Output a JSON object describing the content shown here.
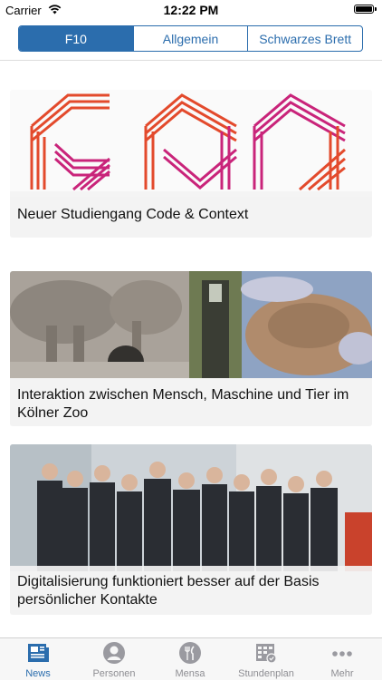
{
  "status_bar": {
    "carrier": "Carrier",
    "time": "12:22 PM"
  },
  "segments": [
    {
      "label": "F10",
      "selected": true
    },
    {
      "label": "Allgemein",
      "selected": false
    },
    {
      "label": "Schwarzes Brett",
      "selected": false
    }
  ],
  "news": [
    {
      "title": "Neuer Studiengang Code & Context"
    },
    {
      "title": "Interaktion zwischen Mensch, Maschine und Tier im Kölner Zoo"
    },
    {
      "title": "Digitalisierung funktioniert besser auf der Basis persönlicher Kontakte"
    }
  ],
  "tabs": [
    {
      "label": "News",
      "icon": "news-icon",
      "active": true
    },
    {
      "label": "Personen",
      "icon": "person-icon",
      "active": false
    },
    {
      "label": "Mensa",
      "icon": "fork-knife-icon",
      "active": false
    },
    {
      "label": "Stundenplan",
      "icon": "timetable-icon",
      "active": false
    },
    {
      "label": "Mehr",
      "icon": "more-icon",
      "active": false
    }
  ],
  "colors": {
    "accent": "#2b6dad",
    "inactive": "#8e8e93",
    "card_bg": "#f3f3f3"
  }
}
